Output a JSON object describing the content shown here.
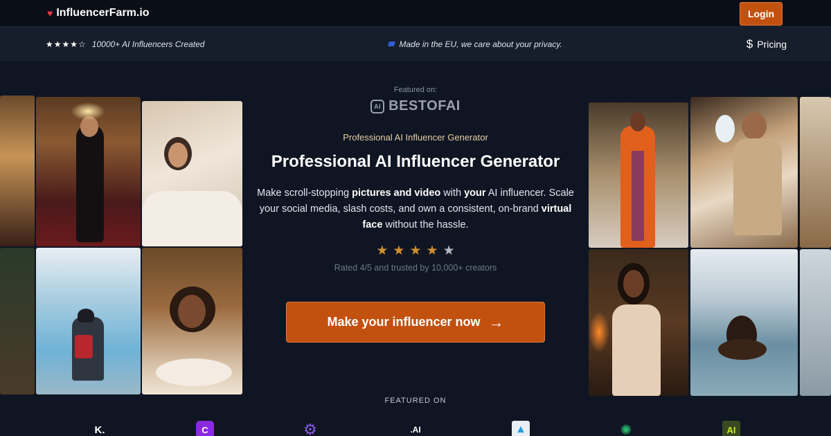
{
  "header": {
    "logo_text": "InfluencerFarm.io",
    "login_label": "Login"
  },
  "subbar": {
    "stars": "★★★★☆",
    "created_text": "10000+ AI Influencers Created",
    "eu_text": "Made in the EU, we care about your privacy.",
    "pricing_label": "Pricing",
    "pricing_icon": "$"
  },
  "hero": {
    "featured_label": "Featured on:",
    "featured_brand": "BESTOFAI",
    "featured_badge": "AI",
    "eyebrow": "Professional AI Influencer Generator",
    "title": "Professional AI Influencer Generator",
    "desc": {
      "p1": "Make scroll-stopping ",
      "b1": "pictures and video",
      "p2": " with ",
      "b2": "your",
      "p3": " AI influencer. Scale your social media, slash costs, and own a consistent, on-brand ",
      "b3": "virtual face",
      "p4": " without the hassle."
    },
    "rating_value": 4,
    "rating_max": 5,
    "rated_text": "Rated 4/5 and trusted by 10,000+ creators",
    "cta_label": "Make your influencer now",
    "cta_arrow": "→"
  },
  "featured_on": {
    "heading": "FEATURED ON",
    "logos": [
      {
        "name": "k-logo",
        "text": "K."
      },
      {
        "name": "c-logo",
        "text": "C"
      },
      {
        "name": "gear-logo",
        "text": "⚙"
      },
      {
        "name": "ai-dot-logo",
        "text": ".AI"
      },
      {
        "name": "a-triangle-logo",
        "text": "▲"
      },
      {
        "name": "network-logo",
        "text": "✺"
      },
      {
        "name": "ai-box-logo",
        "text": "AI"
      }
    ]
  },
  "colors": {
    "accent": "#c2510f",
    "background": "#0f1522",
    "star": "#d28f2b"
  },
  "photos": {
    "left": [
      "woman in black dress in red lounge",
      "woman in white bed with coffee",
      "woman by glacier with red backpack",
      "smiling woman dining by candlelight"
    ],
    "right": [
      "woman in orange coat in marble hall",
      "man with sunglasses in private jet",
      "woman in lace dress by fireplace",
      "woman in steaming hot spring"
    ]
  }
}
